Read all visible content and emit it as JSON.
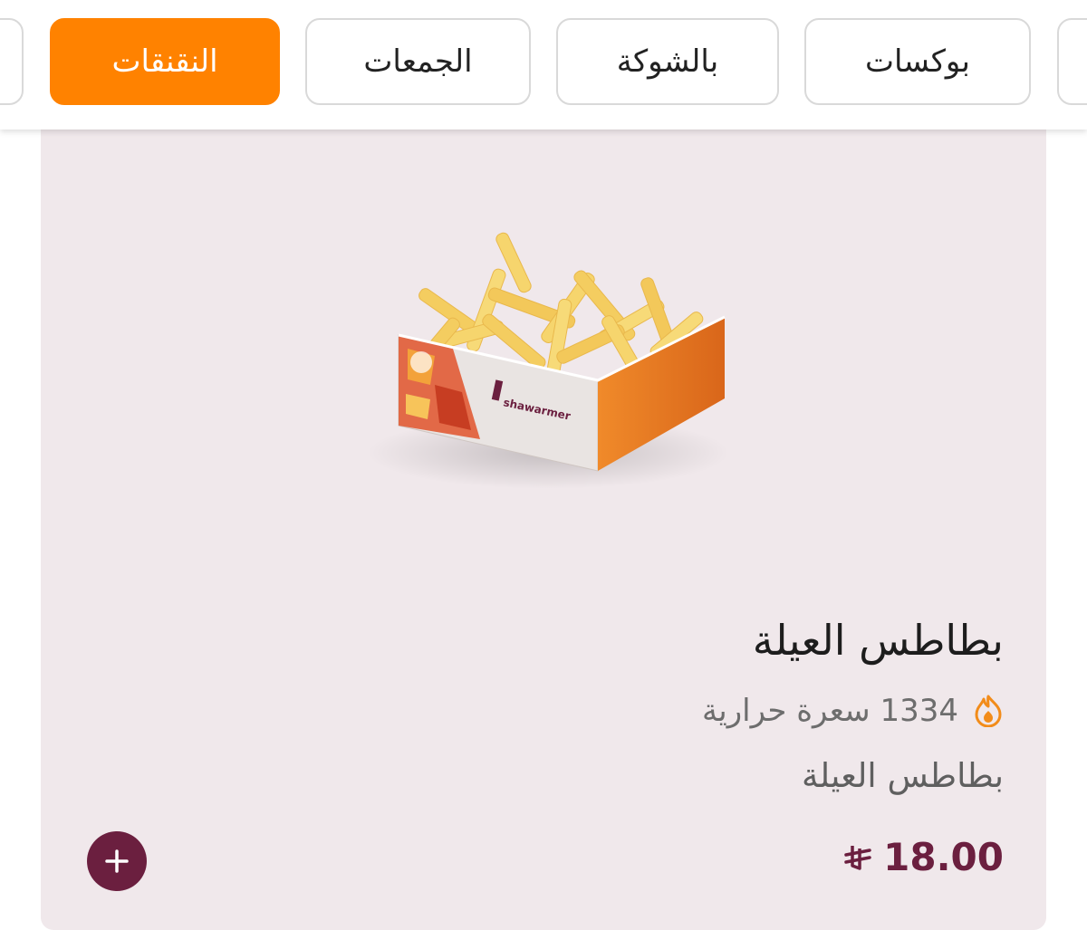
{
  "category_tabs": [
    {
      "label": "بوكسات",
      "active": false
    },
    {
      "label": "بالشوكة",
      "active": false
    },
    {
      "label": "الجمعات",
      "active": false
    },
    {
      "label": "النقنقات",
      "active": true
    }
  ],
  "product": {
    "title": "بطاطس العيلة",
    "calories": "1334 سعرة حرارية",
    "description": "بطاطس العيلة",
    "price": "18.00",
    "currency_icon": "riyal-symbol-icon",
    "image_icon": "fries-box-image",
    "add_icon": "plus-icon"
  },
  "colors": {
    "accent": "#ff8200",
    "brand": "#6b1f3f",
    "card_bg": "#f0e8eb"
  }
}
